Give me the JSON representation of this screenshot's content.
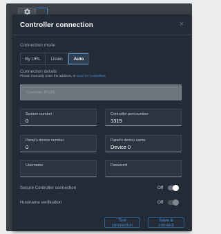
{
  "dialog": {
    "title": "Controller connection",
    "close_icon": "×"
  },
  "connection_mode": {
    "label": "Connection mode",
    "options": [
      "By URL",
      "Listen",
      "Auto"
    ],
    "selected": "Auto"
  },
  "connection_details": {
    "label": "Connection details",
    "hint_prefix": "Please manually enter the address, or",
    "hint_link": "scan for Controllers."
  },
  "url_input": {
    "placeholder": "Controller IP/URL",
    "value": ""
  },
  "fields": {
    "system_number": {
      "label": "System number",
      "value": "0"
    },
    "controller_port": {
      "label": "Controller port number",
      "value": "1319"
    },
    "panel_device_number": {
      "label": "Panel's device number",
      "value": "0"
    },
    "panel_device_name": {
      "label": "Panel's device name",
      "value": "Device 0"
    },
    "username": {
      "label": "Username",
      "value": ""
    },
    "password": {
      "label": "Password",
      "value": ""
    }
  },
  "toggles": {
    "secure": {
      "label": "Secure Controller connection",
      "state": "Off"
    },
    "hostname": {
      "label": "Hostname verification",
      "state": "Off"
    }
  },
  "buttons": {
    "test": "Test connection",
    "save": "Save & connect"
  },
  "colors": {
    "accent": "#4d8fd9",
    "dialog_bg": "#232b36"
  }
}
